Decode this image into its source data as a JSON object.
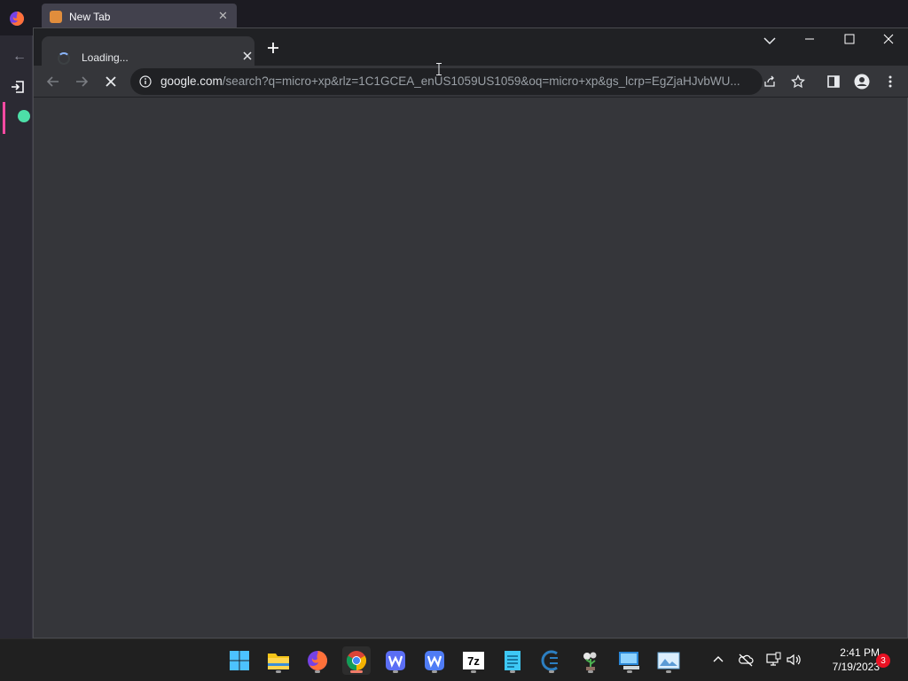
{
  "background_window": {
    "tab_title": "New Tab"
  },
  "chrome": {
    "tab": {
      "title": "Loading..."
    },
    "address_bar": {
      "url_host": "google.com",
      "url_rest": "/search?q=micro+xp&rlz=1C1GCEA_enUS1059US1059&oq=micro+xp&gs_lcrp=EgZjaHJvbWU..."
    },
    "icons": {
      "tab_loading": "loading-spinner-icon",
      "tab_close": "close-icon",
      "new_tab": "plus-icon",
      "tab_search": "chevron-down-icon",
      "minimize": "minimize-icon",
      "maximize": "maximize-icon",
      "close_window": "close-icon",
      "back": "arrow-left-icon",
      "forward": "arrow-right-icon",
      "stop": "close-icon",
      "site_info": "info-icon",
      "share": "share-icon",
      "bookmark": "star-icon",
      "side_panel": "side-panel-icon",
      "profile": "profile-icon",
      "menu": "more-vert-icon"
    }
  },
  "taskbar": {
    "apps": [
      {
        "name": "start",
        "icon": "windows-start-icon"
      },
      {
        "name": "file-explorer",
        "icon": "folder-icon"
      },
      {
        "name": "firefox",
        "icon": "firefox-icon"
      },
      {
        "name": "chrome",
        "icon": "chrome-icon",
        "active": true
      },
      {
        "name": "writer-1",
        "icon": "w-app-icon"
      },
      {
        "name": "writer-2",
        "icon": "w-app-icon"
      },
      {
        "name": "7zip",
        "icon": "sevenzip-icon",
        "label": "7z"
      },
      {
        "name": "notepad",
        "icon": "notepad-icon"
      },
      {
        "name": "eclipse",
        "icon": "eclipse-icon"
      },
      {
        "name": "plant-app",
        "icon": "plant-icon"
      },
      {
        "name": "remote-desktop",
        "icon": "remote-desktop-icon"
      },
      {
        "name": "photos",
        "icon": "photos-icon"
      }
    ],
    "clock": {
      "time": "2:41 PM",
      "date": "7/19/2023"
    },
    "notification_count": "3"
  },
  "colors": {
    "chrome_frame": "#202124",
    "chrome_content": "#35363a",
    "accent_blue": "#8ab4f8",
    "taskbar": "#202020",
    "badge_red": "#e81123"
  }
}
